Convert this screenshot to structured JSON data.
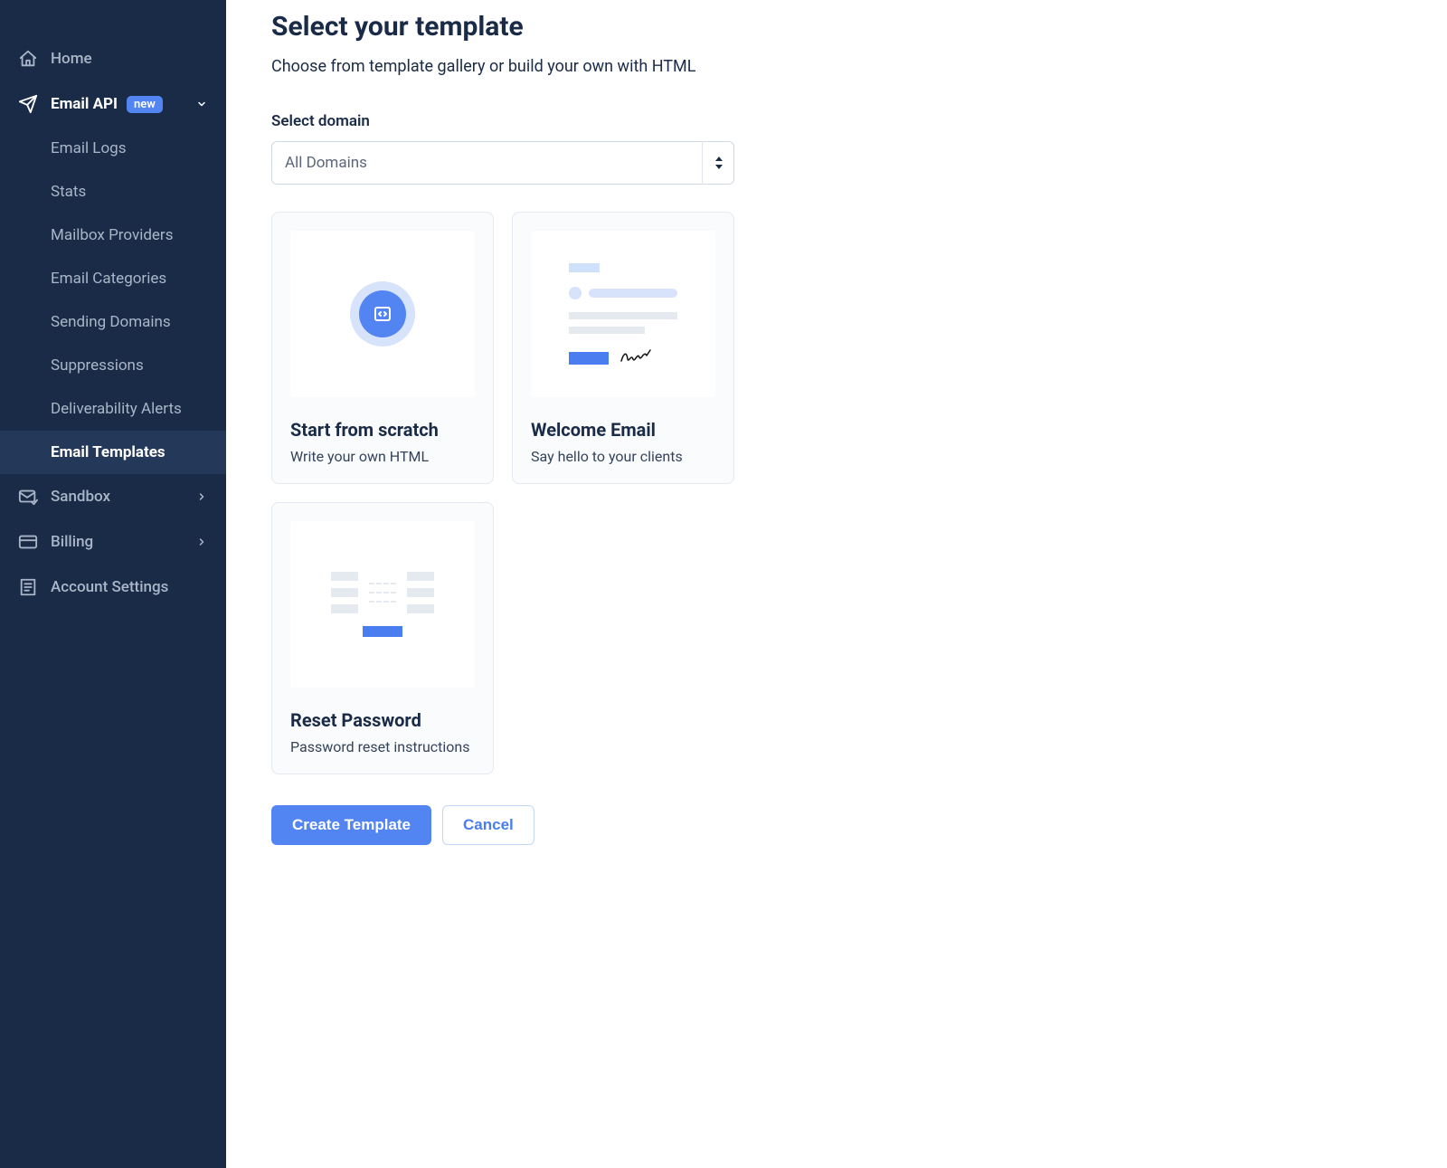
{
  "sidebar": {
    "home": "Home",
    "email_api": {
      "label": "Email API",
      "badge": "new"
    },
    "sub": {
      "email_logs": "Email Logs",
      "stats": "Stats",
      "mailbox_providers": "Mailbox Providers",
      "email_categories": "Email Categories",
      "sending_domains": "Sending Domains",
      "suppressions": "Suppressions",
      "deliverability_alerts": "Deliverability Alerts",
      "email_templates": "Email Templates"
    },
    "sandbox": "Sandbox",
    "billing": "Billing",
    "account_settings": "Account Settings"
  },
  "page": {
    "title": "Select your template",
    "subtitle": "Choose from template gallery or build your own with HTML",
    "domain_label": "Select domain",
    "domain_selected": "All Domains"
  },
  "templates": {
    "scratch": {
      "title": "Start from scratch",
      "desc": "Write your own HTML"
    },
    "welcome": {
      "title": "Welcome Email",
      "desc": "Say hello to your clients"
    },
    "reset": {
      "title": "Reset Password",
      "desc": "Password reset instructions"
    }
  },
  "buttons": {
    "create": "Create Template",
    "cancel": "Cancel"
  }
}
